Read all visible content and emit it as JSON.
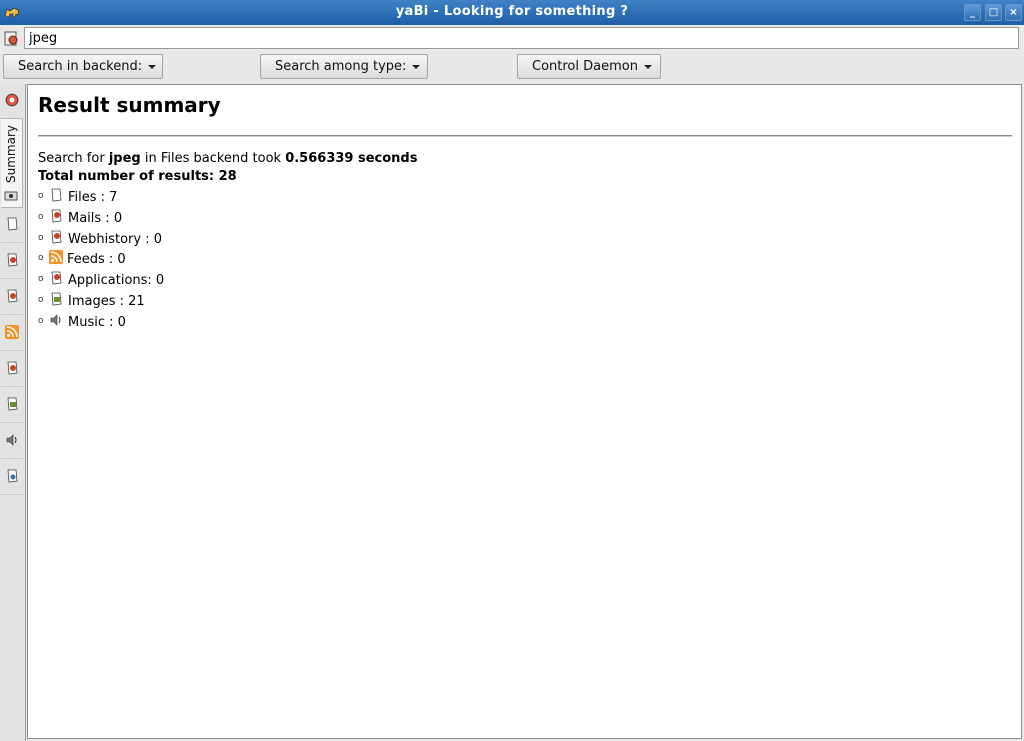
{
  "window": {
    "title": "yaBi - Looking for something ?",
    "controls": [
      "minimize-icon",
      "maximize-icon",
      "close-icon"
    ]
  },
  "search": {
    "value": "jpeg",
    "placeholder": ""
  },
  "toolbar": {
    "backend_label": "Search in backend:",
    "type_label": "Search among type:",
    "daemon_label": "Control Daemon"
  },
  "sidebar": {
    "summary_tab_label": "Summary",
    "tabs": [
      "summary",
      "files",
      "mails",
      "webhistory",
      "feeds",
      "applications",
      "images",
      "music",
      "other"
    ]
  },
  "summary": {
    "title": "Result summary",
    "search_prefix": "Search for ",
    "query": "jpeg",
    "backend_text": " in Files backend took ",
    "duration": "0.566339 seconds",
    "total": "Total number of results: 28",
    "results": [
      {
        "label": "Files : 7",
        "icon": "file-icon"
      },
      {
        "label": "Mails : 0",
        "icon": "mail-icon"
      },
      {
        "label": "Webhistory : 0",
        "icon": "webhistory-icon"
      },
      {
        "label": "Feeds : 0",
        "icon": "rss-feed-icon"
      },
      {
        "label": "Applications: 0",
        "icon": "application-icon"
      },
      {
        "label": "Images : 21",
        "icon": "image-icon"
      },
      {
        "label": "Music : 0",
        "icon": "speaker-icon"
      }
    ]
  },
  "colors": {
    "titlebar": "#1d5ea6",
    "feed_icon": "#f49224",
    "doc_icon_red": "#c8432a"
  }
}
